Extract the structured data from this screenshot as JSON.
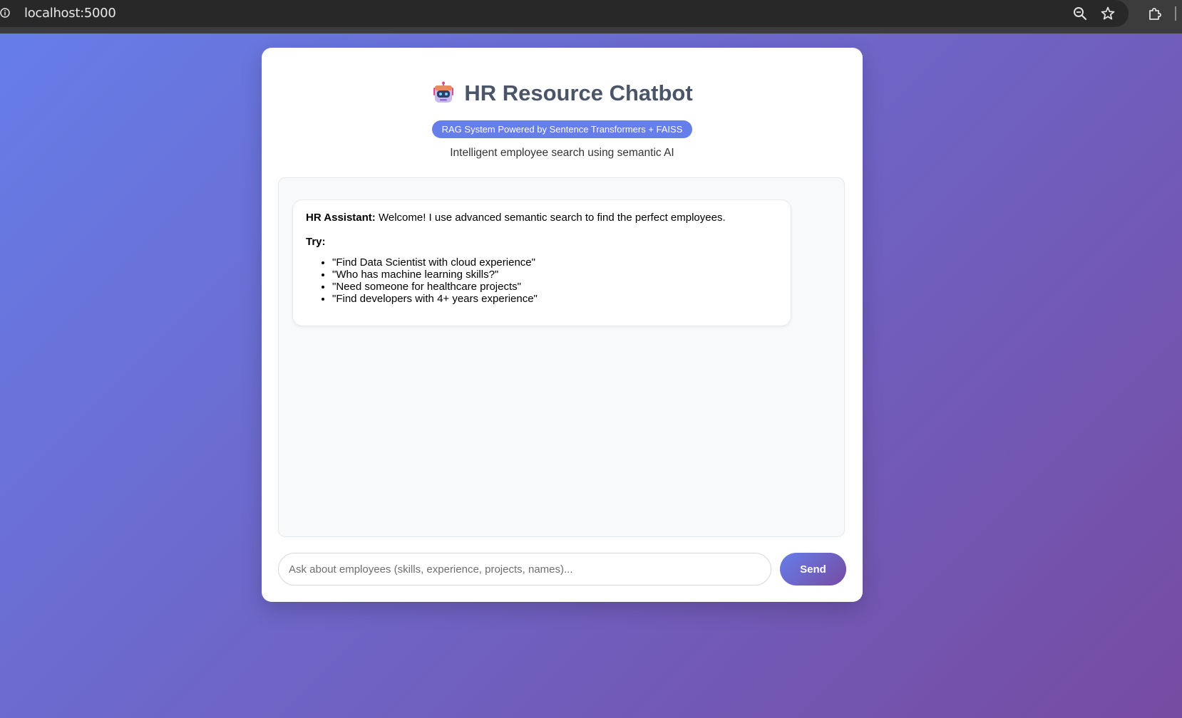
{
  "browser": {
    "url": "localhost:5000",
    "icons": [
      "info-icon",
      "zoom-icon",
      "star-icon",
      "extensions-icon"
    ]
  },
  "header": {
    "icon": "robot-icon",
    "title": "HR Resource Chatbot",
    "badge": "RAG System Powered by Sentence Transformers + FAISS",
    "subtitle": "Intelligent employee search using semantic AI"
  },
  "chat": {
    "messages": [
      {
        "sender": "HR Assistant:",
        "text": "Welcome! I use advanced semantic search to find the perfect employees.",
        "try_label": "Try:",
        "suggestions": [
          "\"Find Data Scientist with cloud experience\"",
          "\"Who has machine learning skills?\"",
          "\"Need someone for healthcare projects\"",
          "\"Find developers with 4+ years experience\""
        ]
      }
    ]
  },
  "input": {
    "placeholder": "Ask about employees (skills, experience, projects, names)...",
    "value": ""
  },
  "send": {
    "label": "Send"
  },
  "colors": {
    "gradient_start": "#667eea",
    "gradient_end": "#764ba2",
    "badge": "#667eea",
    "title": "#4a5568"
  }
}
